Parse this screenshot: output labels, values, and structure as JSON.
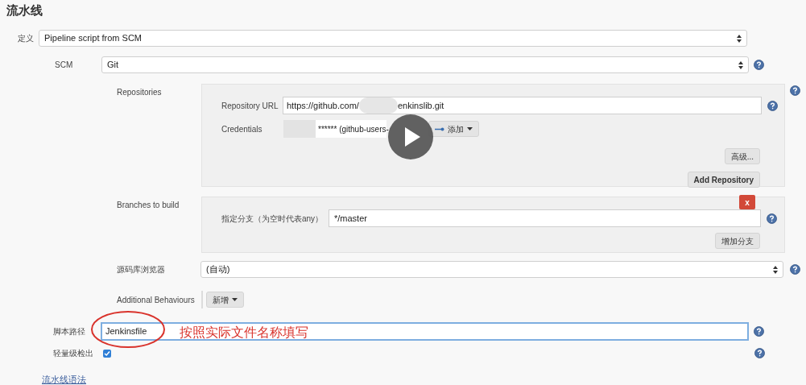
{
  "section_title": "流水线",
  "definition": {
    "label": "定义",
    "value": "Pipeline script from SCM"
  },
  "scm": {
    "label": "SCM",
    "value": "Git"
  },
  "repositories": {
    "label": "Repositories",
    "url_label": "Repository URL",
    "url_start": "https://github.com/",
    "url_end": "enkinslib.git",
    "credentials_label": "Credentials",
    "credentials_value": "****** (github-users-",
    "add_button": "添加",
    "advanced_button": "高级...",
    "add_repository_button": "Add Repository"
  },
  "branches": {
    "label": "Branches to build",
    "delete_button": "x",
    "branch_label": "指定分支（为空时代表any）",
    "branch_value": "*/master",
    "add_branch_button": "增加分支"
  },
  "browser": {
    "label": "源码库浏览器",
    "value": "(自动)"
  },
  "behaviours": {
    "label": "Additional Behaviours",
    "add_button": "新增"
  },
  "script_path": {
    "label": "脚本路径",
    "value": "Jenkinsfile",
    "annotation": "按照实际文件名称填写"
  },
  "lightweight": {
    "label": "轻量级检出",
    "checked": true
  },
  "syntax_link": "流水线语法"
}
